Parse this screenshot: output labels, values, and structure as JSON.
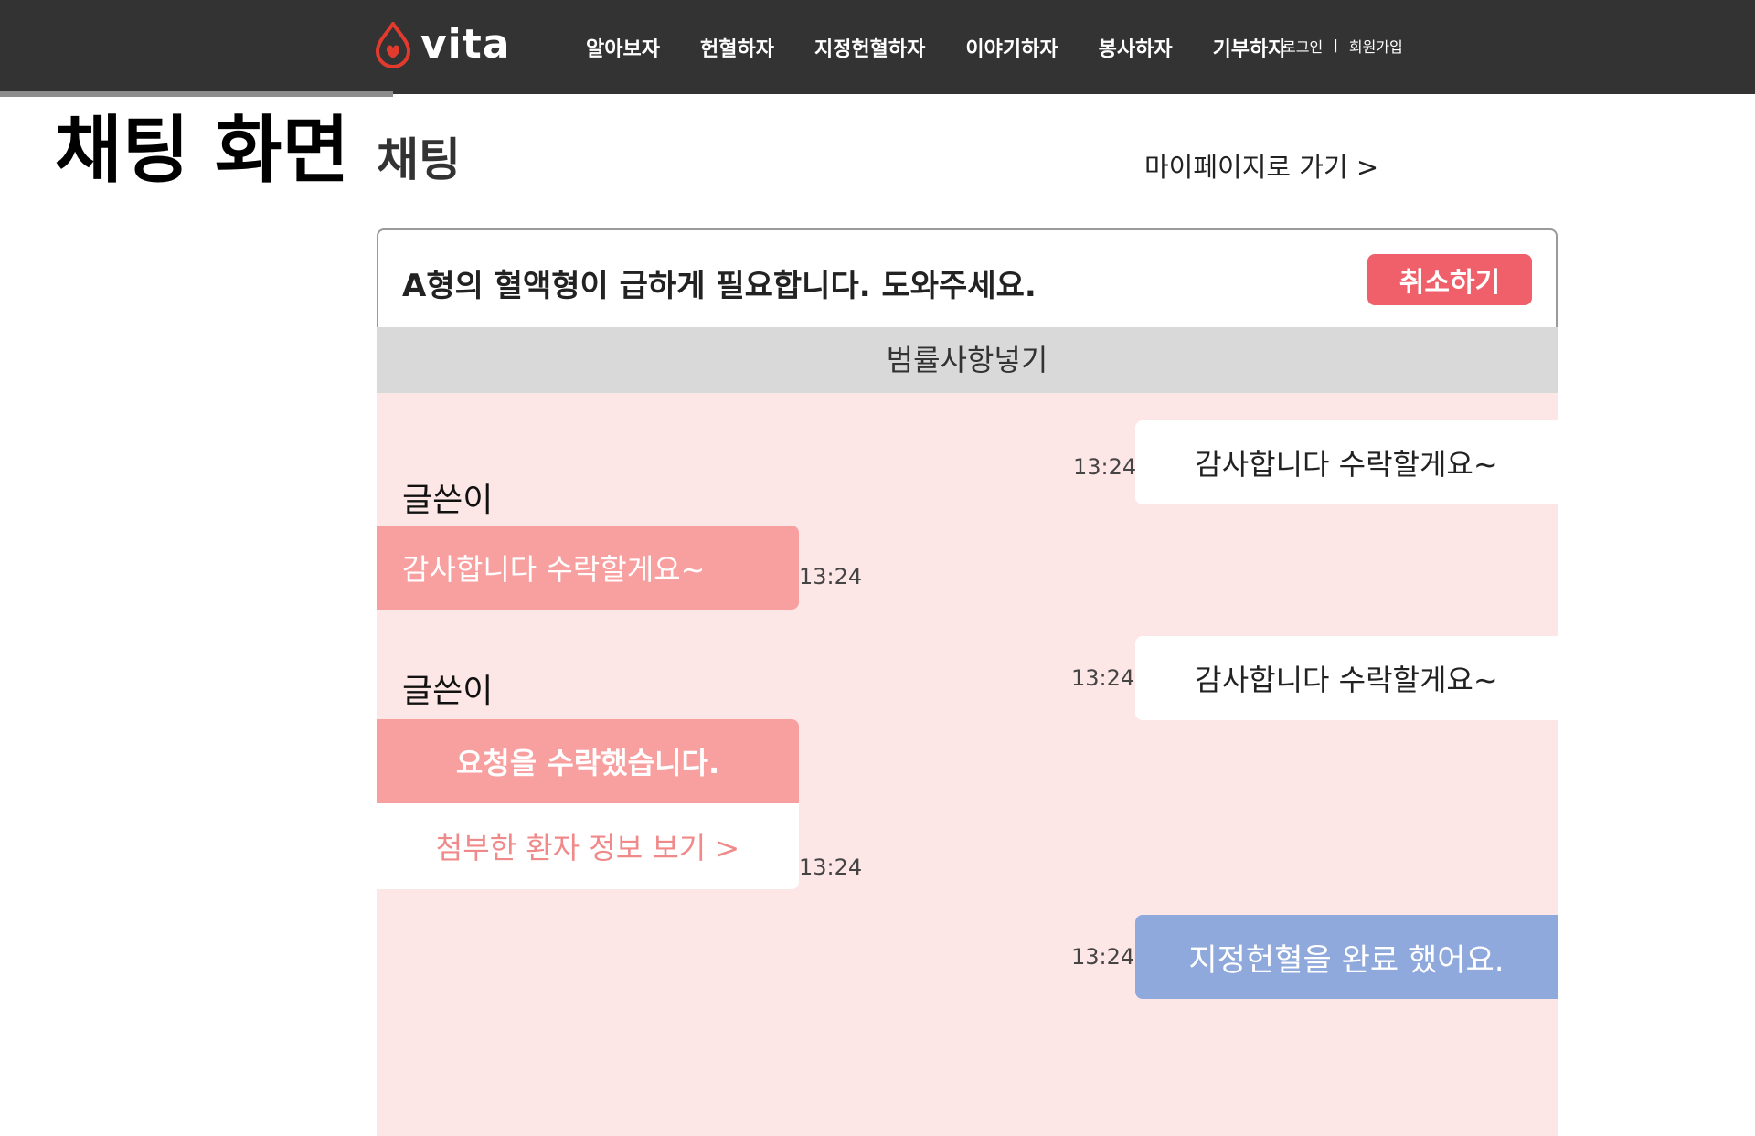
{
  "brand": {
    "logo_text": "vita"
  },
  "nav": {
    "items": [
      {
        "label": "알아보자"
      },
      {
        "label": "헌혈하자"
      },
      {
        "label": "지정헌혈하자"
      },
      {
        "label": "이야기하자"
      },
      {
        "label": "봉사하자"
      },
      {
        "label": "기부하자"
      }
    ],
    "login": "로그인",
    "separator": "|",
    "signup": "회원가입"
  },
  "page": {
    "label": "채팅 화면",
    "title": "채팅",
    "mypage_link": "마이페이지로 가기 >"
  },
  "chat": {
    "request_title": "A형의 혈액형이 급하게 필요합니다. 도와주세요.",
    "cancel_label": "취소하기",
    "rules_label": "범률사항넣기",
    "messages": [
      {
        "side": "right",
        "text": "감사합니다 수락할게요~",
        "time": "13:24"
      },
      {
        "side": "left",
        "sender": "글쓴이",
        "text": "감사합니다 수락할게요~",
        "time": "13:24"
      },
      {
        "side": "right",
        "text": "감사합니다 수락할게요~",
        "time": "13:24"
      },
      {
        "side": "left",
        "sender": "글쓴이",
        "text": "요청을 수락했습니다.",
        "link": "첨부한 환자 정보 보기 >",
        "time": "13:24"
      },
      {
        "side": "right",
        "text": "지정헌혈을 완료 했어요.",
        "time": "13:24"
      }
    ]
  },
  "colors": {
    "topbar": "#333333",
    "accent_red": "#f0606a",
    "bubble_pink": "#f8a0a0",
    "chat_bg": "#fde6e6",
    "bubble_blue": "#8fa9dc"
  }
}
